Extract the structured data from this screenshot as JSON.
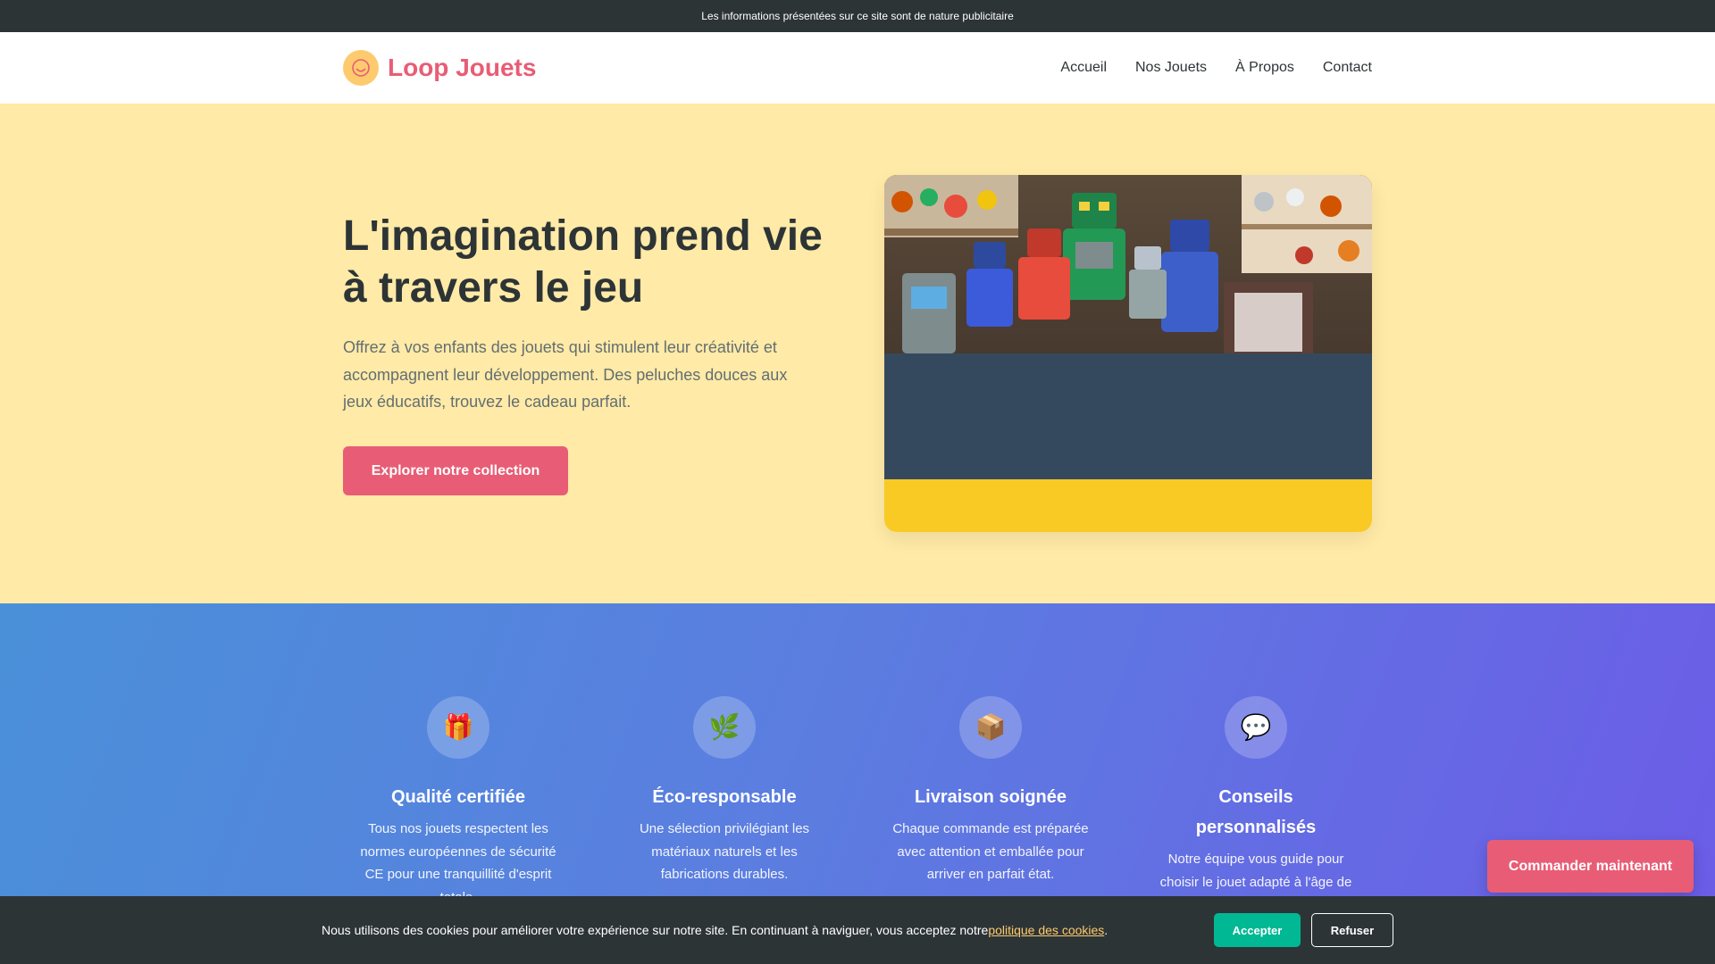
{
  "topbar": {
    "text": "Les informations présentées sur ce site sont de nature publicitaire"
  },
  "header": {
    "brand": "Loop Jouets",
    "logo_icon": "smiley-icon",
    "nav": [
      "Accueil",
      "Nos Jouets",
      "À Propos",
      "Contact"
    ]
  },
  "hero": {
    "title": "L'imagination prend vie à travers le jeu",
    "text": "Offrez à vos enfants des jouets qui stimulent leur créativité et accompagnent leur développement. Des peluches douces aux jeux éducatifs, trouvez le cadeau parfait.",
    "button": "Explorer notre collection",
    "image_subject": "vintage toy robots and toy cars"
  },
  "features": [
    {
      "icon": "🎁",
      "icon_name": "gift-icon",
      "title": "Qualité certifiée",
      "text": "Tous nos jouets respectent les normes européennes de sécurité CE pour une tranquillité d'esprit totale."
    },
    {
      "icon": "🌿",
      "icon_name": "leaf-icon",
      "title": "Éco-responsable",
      "text": "Une sélection privilégiant les matériaux naturels et les fabrications durables."
    },
    {
      "icon": "📦",
      "icon_name": "package-icon",
      "title": "Livraison soignée",
      "text": "Chaque commande est préparée avec attention et emballée pour arriver en parfait état."
    },
    {
      "icon": "💬",
      "icon_name": "speech-bubble-icon",
      "title": "Conseils personnalisés",
      "text": "Notre équipe vous guide pour choisir le jouet adapté à l'âge de votre enfant."
    }
  ],
  "floating_button": "Commander maintenant",
  "cookie": {
    "text_before": "Nous utilisons des cookies pour améliorer votre expérience sur notre site. En continuant à naviguer, vous acceptez notre ",
    "link": "politique des cookies",
    "text_after": ".",
    "accept": "Accepter",
    "refuse": "Refuser"
  },
  "colors": {
    "brand": "#e85d75",
    "hero_bg": "#ffeaa7",
    "dark": "#2d3436",
    "accept": "#00b894",
    "gradient_start": "#4a90d9",
    "gradient_end": "#6c5ce7"
  }
}
